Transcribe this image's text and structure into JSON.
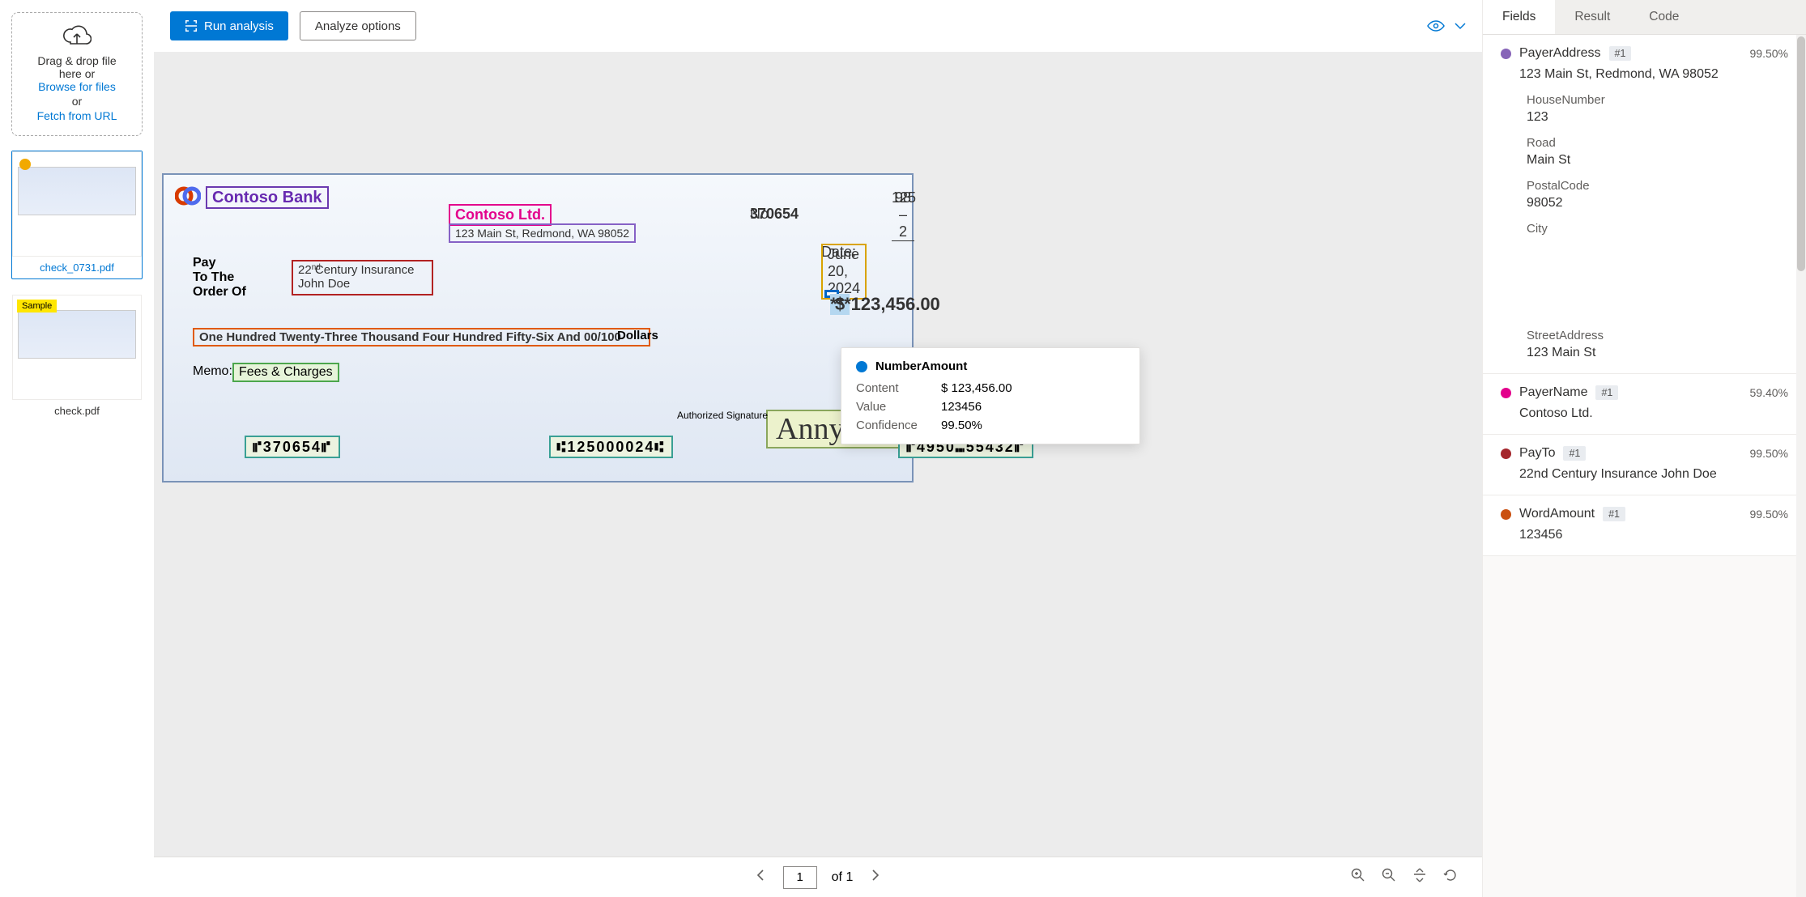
{
  "buttons": {
    "run": "Run analysis",
    "analyze": "Analyze options"
  },
  "drop": {
    "line1": "Drag & drop file",
    "line2": "here or",
    "browse": "Browse for files",
    "or": "or",
    "fetch": "Fetch from URL"
  },
  "thumbs": {
    "file1": "check_0731.pdf",
    "file2": "check.pdf",
    "sample": "Sample"
  },
  "check": {
    "bank": "Contoso Bank",
    "payer": "Contoso Ltd.",
    "addr": "123 Main St, Redmond, WA 98052",
    "no_lbl": "No. ",
    "no": "370654",
    "routing_top": "98 – 2",
    "routing_bot": "125",
    "date_lbl": "Date: ",
    "date": "June 20, 2024",
    "payto_lbl": "Pay\nTo The\nOrder Of",
    "payto_l1": "22nd Century Insurance",
    "payto_l2": "John Doe",
    "amount_num": "***123,456.00",
    "amount_words": "One Hundred Twenty-Three Thousand Four Hundred Fifty-Six And 00/100",
    "dollars": "Dollars",
    "memo_lbl": "Memo:",
    "memo": "Fees & Charges",
    "sig": "AnnyWalke",
    "sig_lbl": "Authorized Signature",
    "micr1": "⑈370654⑈",
    "micr2": "⑆125000024⑆",
    "micr3": "⑈4950⑉55432⑈"
  },
  "flyout": {
    "title": "NumberAmount",
    "content_k": "Content",
    "content_v": "$ 123,456.00",
    "value_k": "Value",
    "value_v": "123456",
    "conf_k": "Confidence",
    "conf_v": "99.50%"
  },
  "pager": {
    "page": "1",
    "of": "of 1"
  },
  "tabs": {
    "fields": "Fields",
    "result": "Result",
    "code": "Code"
  },
  "fields": {
    "payerAddress": {
      "name": "PayerAddress",
      "badge": "#1",
      "conf": "99.50%",
      "val": "123 Main St, Redmond, WA 98052"
    },
    "sub": {
      "house_k": "HouseNumber",
      "house_v": "123",
      "road_k": "Road",
      "road_v": "Main St",
      "postal_k": "PostalCode",
      "postal_v": "98052",
      "city_k": "City",
      "street_k": "StreetAddress",
      "street_v": "123 Main St"
    },
    "payerName": {
      "name": "PayerName",
      "badge": "#1",
      "conf": "59.40%",
      "val": "Contoso Ltd."
    },
    "payTo": {
      "name": "PayTo",
      "badge": "#1",
      "conf": "99.50%",
      "val": "22nd Century Insurance John Doe"
    },
    "wordAmount": {
      "name": "WordAmount",
      "badge": "#1",
      "conf": "99.50%",
      "val": "123456"
    }
  }
}
